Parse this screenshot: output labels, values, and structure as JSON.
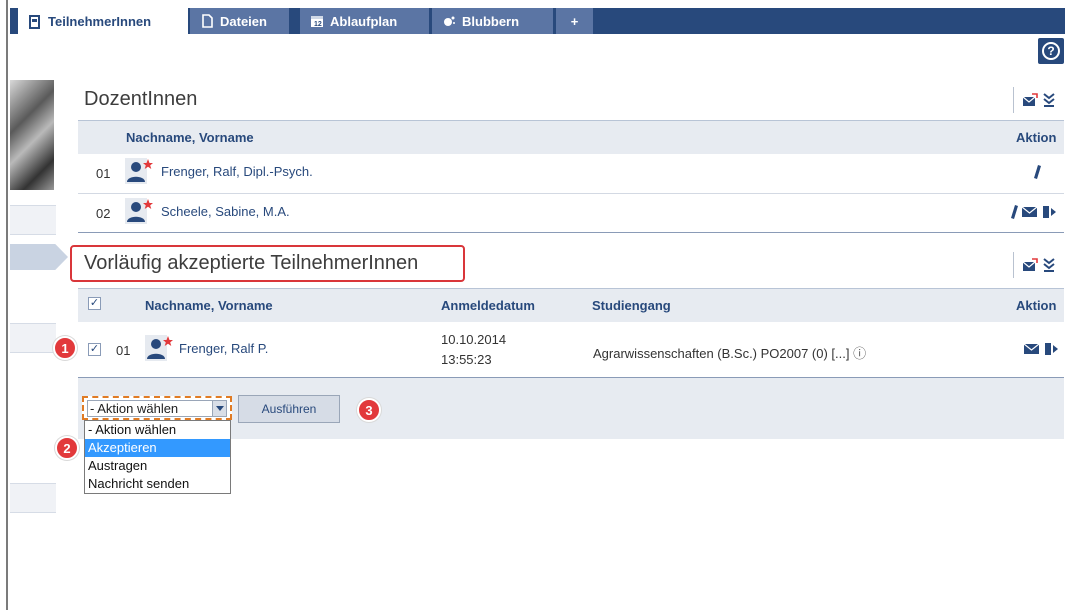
{
  "tabs": [
    {
      "label": "TeilnehmerInnen",
      "active": true,
      "icon": "person-card-icon"
    },
    {
      "label": "Dateien",
      "active": false,
      "icon": "file-icon"
    },
    {
      "label": "Ablaufplan",
      "active": false,
      "icon": "calendar-icon"
    },
    {
      "label": "Blubbern",
      "active": false,
      "icon": "bubbles-icon"
    },
    {
      "label": "+",
      "active": false,
      "icon": ""
    }
  ],
  "help_symbol": "?",
  "lecturers": {
    "title": "DozentInnen",
    "col_name": "Nachname, Vorname",
    "col_action": "Aktion",
    "rows": [
      {
        "num": "01",
        "name": "Frenger, Ralf, Dipl.-Psych."
      },
      {
        "num": "02",
        "name": "Scheele, Sabine, M.A."
      }
    ]
  },
  "accepted": {
    "title": "Vorläufig akzeptierte TeilnehmerInnen",
    "col_name": "Nachname, Vorname",
    "col_date": "Anmeldedatum",
    "col_program": "Studiengang",
    "col_action": "Aktion",
    "rows": [
      {
        "num": "01",
        "name": "Frenger, Ralf P.",
        "date": "10.10.2014",
        "time": "13:55:23",
        "program": "Agrarwissenschaften (B.Sc.) PO2007 (0) [...]",
        "info_symbol": "ⓘ"
      }
    ]
  },
  "action_select": {
    "selected": "- Aktion wählen",
    "options": [
      "- Aktion wählen",
      "Akzeptieren",
      "Austragen",
      "Nachricht senden"
    ],
    "highlighted_index": 1
  },
  "run_button": "Ausführen",
  "badges": [
    "1",
    "2",
    "3"
  ],
  "colors": {
    "brand": "#28497c",
    "badge": "#e2393b",
    "highlight_option": "#3399ff",
    "dashed": "#e07b24"
  }
}
